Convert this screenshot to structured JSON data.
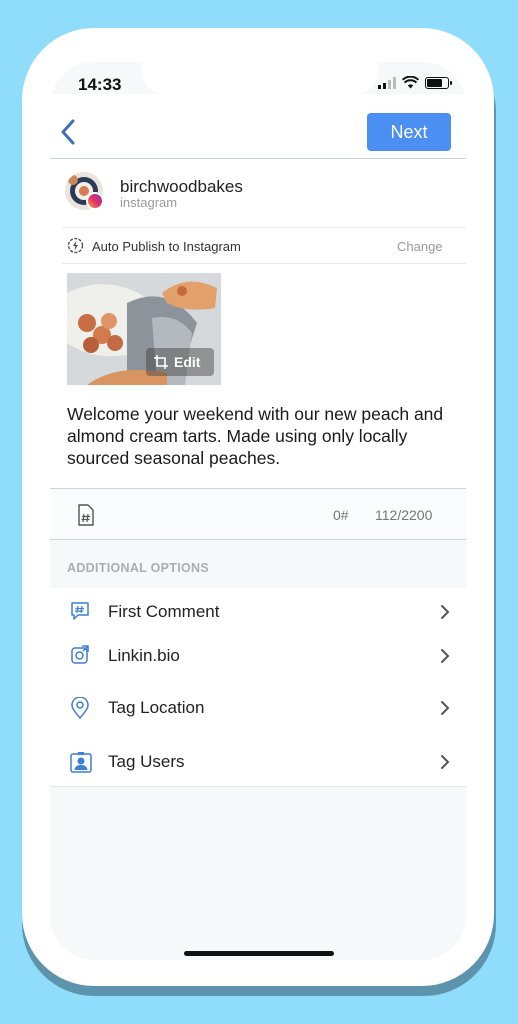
{
  "status_bar": {
    "time": "14:33"
  },
  "header": {
    "next_label": "Next"
  },
  "account": {
    "name": "birchwoodbakes",
    "network": "instagram"
  },
  "publish": {
    "label": "Auto Publish to Instagram",
    "change_label": "Change"
  },
  "media": {
    "edit_label": "Edit"
  },
  "caption": {
    "text": "Welcome your weekend with our new peach and almond cream tarts. Made using only locally sourced seasonal peaches."
  },
  "caption_bar": {
    "hashtag_count": "0#",
    "char_count": "112/2200"
  },
  "options": {
    "title": "ADDITIONAL OPTIONS",
    "items": [
      {
        "label": "First Comment",
        "icon": "comment-hash-icon"
      },
      {
        "label": "Linkin.bio",
        "icon": "linkin-bio-icon"
      },
      {
        "label": "Tag Location",
        "icon": "location-pin-icon"
      },
      {
        "label": "Tag Users",
        "icon": "tag-users-icon"
      }
    ]
  },
  "colors": {
    "accent": "#4a8ff1",
    "icon_blue": "#3d7fd6",
    "background": "#8fdcfb"
  }
}
